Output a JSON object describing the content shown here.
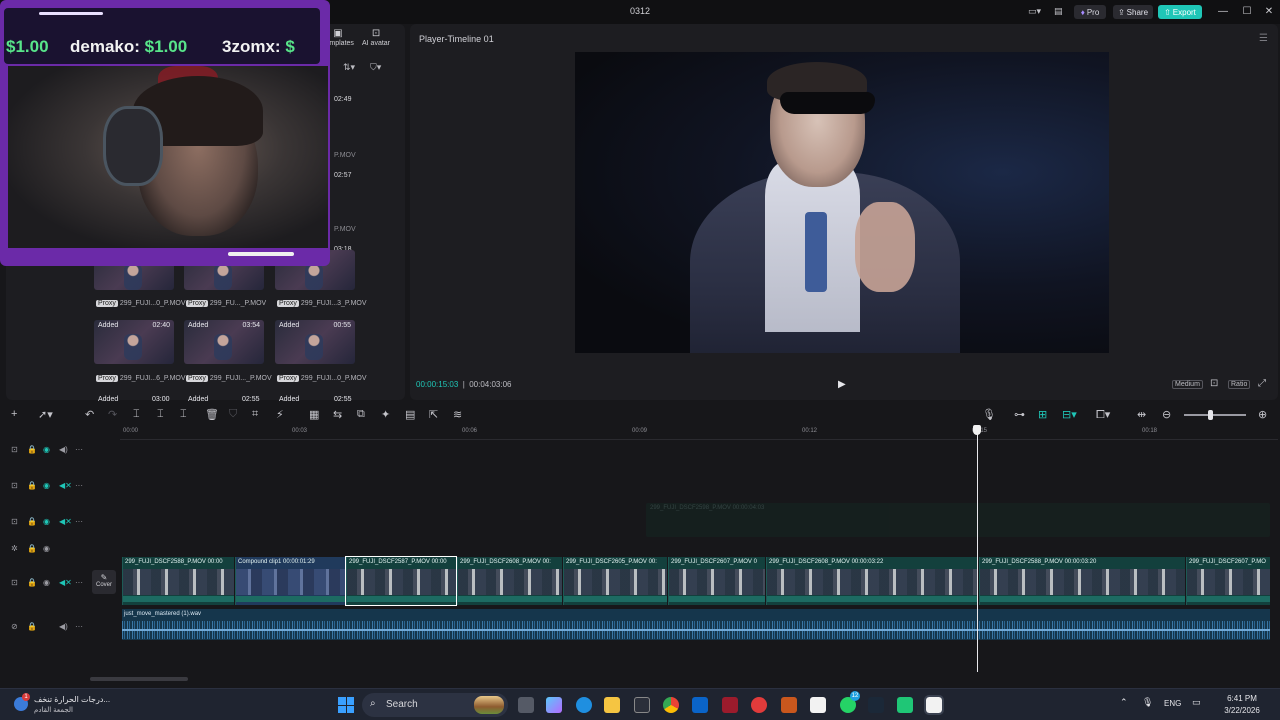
{
  "window": {
    "title": "0312",
    "pro_label": "Pro",
    "share_label": "Share",
    "export_label": "Export"
  },
  "media_panel": {
    "templates_label": "Templates",
    "ai_avatar_label": "AI avatar",
    "side_durations": [
      "02:49",
      "02:57",
      "03:18"
    ],
    "side_labels": [
      "P.MOV",
      "P.MOV"
    ],
    "thumbs_row1": [
      {
        "label": "299_FUJI...0_P.MOV",
        "proxy": "Proxy"
      },
      {
        "label": "299_FU..._P.MOV",
        "proxy": "Proxy"
      },
      {
        "label": "299_FUJI...3_P.MOV",
        "proxy": "Proxy"
      }
    ],
    "thumbs_row2": [
      {
        "added": "Added",
        "duration": "02:40",
        "label": "299_FUJI...6_P.MOV",
        "proxy": "Proxy"
      },
      {
        "added": "Added",
        "duration": "03:54",
        "label": "299_FUJI..._P.MOV",
        "proxy": "Proxy"
      },
      {
        "added": "Added",
        "duration": "00:55",
        "label": "299_FUJI...0_P.MOV",
        "proxy": "Proxy"
      }
    ],
    "row3_partial": [
      "Added",
      "03:00",
      "Added",
      "02:55",
      "Added",
      "02:55"
    ]
  },
  "webcam": {
    "donations": [
      {
        "name": "",
        "amount": "$1.00"
      },
      {
        "name": "demako:",
        "amount": "$1.00"
      },
      {
        "name": "3zomx:",
        "amount": "$"
      }
    ]
  },
  "player": {
    "title": "Player-Timeline 01",
    "current_time": "00:00:15:03",
    "total_time": "00:04:03:06",
    "quality_label": "Medium",
    "ratio_label": "Ratio"
  },
  "timeline": {
    "ruler_ticks": [
      "00:00",
      "00:03",
      "00:06",
      "00:09",
      "00:12",
      "00:15",
      "00:18"
    ],
    "ghost_clip_label": "299_FUJI_DSCF2598_P.MOV  00:00:04:03",
    "cover_label": "Cover",
    "video_clips": [
      {
        "label": "299_FUJI_DSCF2588_P.MOV  00:00",
        "compound": false,
        "selected": false
      },
      {
        "label": "Compound clip1  00:00:01:29",
        "compound": true,
        "selected": false
      },
      {
        "label": "299_FUJI_DSCF2587_P.MOV  00:00",
        "compound": false,
        "selected": true
      },
      {
        "label": "299_FUJI_DSCF2608_P.MOV  00:",
        "compound": false,
        "selected": false
      },
      {
        "label": "299_FUJI_DSCF2605_P.MOV  00:",
        "compound": false,
        "selected": false
      },
      {
        "label": "299_FUJI_DSCF2607_P.MOV  0",
        "compound": false,
        "selected": false
      },
      {
        "label": "299_FUJI_DSCF2608_P.MOV  00:00:03:22",
        "compound": false,
        "selected": false
      },
      {
        "label": "299_FUJI_DSCF2588_P.MOV  00:00:03:20",
        "compound": false,
        "selected": false
      },
      {
        "label": "299_FUJI_DSCF2607_P.MO",
        "compound": false,
        "selected": false
      }
    ],
    "audio_clip_label": "just_move_mastered (1).wav"
  },
  "taskbar": {
    "weather_line1": "درجات الحرارة تنخف...",
    "weather_line2": "الجمعة القادم",
    "weather_badge": "1",
    "search_label": "Search",
    "language": "ENG",
    "time": "6:41 PM",
    "date": "3/22/2026",
    "notification_count": "12"
  },
  "colors": {
    "accent": "#1fc6b7",
    "webcam_frame": "#6b2aa8",
    "donation_amount": "#58e58a",
    "audio_clip": "#15364c",
    "video_clip": "#13403d"
  }
}
